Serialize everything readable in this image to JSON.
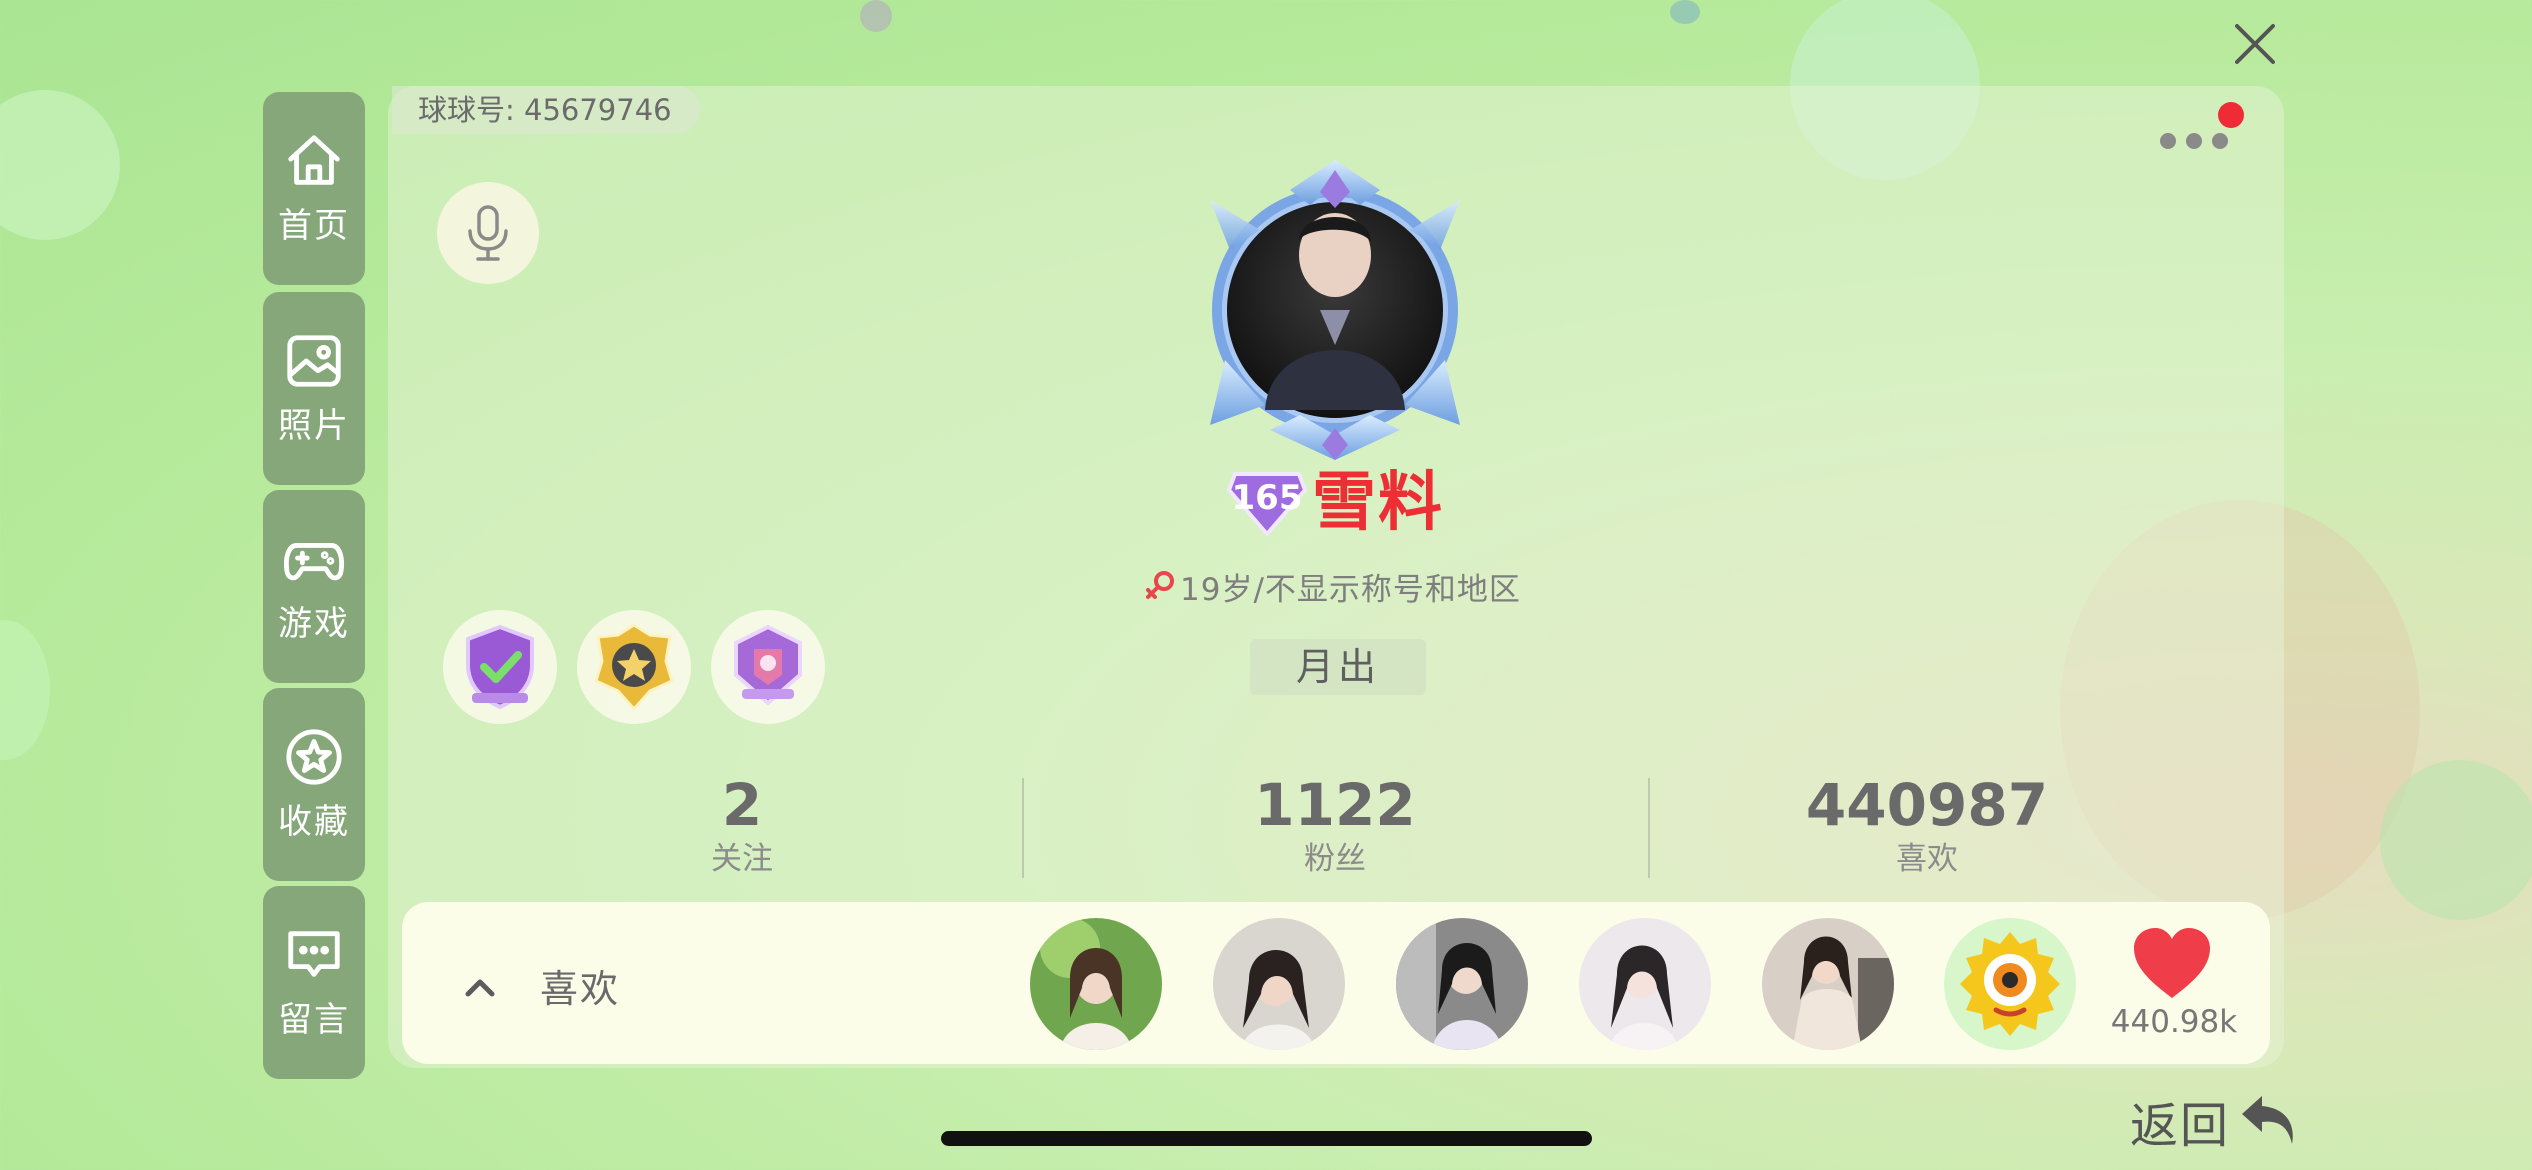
{
  "header": {
    "uid_label": "球球号: 45679746"
  },
  "sidebar": {
    "items": [
      {
        "label": "首页",
        "icon": "home-icon"
      },
      {
        "label": "照片",
        "icon": "photo-icon"
      },
      {
        "label": "游戏",
        "icon": "gamepad-icon"
      },
      {
        "label": "收藏",
        "icon": "star-icon"
      },
      {
        "label": "留言",
        "icon": "message-icon"
      }
    ]
  },
  "profile": {
    "level": "165",
    "nickname": "雪料",
    "info": "19岁/不显示称号和地区",
    "sign": "月出",
    "medals": [
      "verified-shield-medal",
      "gold-star-medal",
      "purple-badge-medal"
    ]
  },
  "stats": [
    {
      "value": "2",
      "label": "关注"
    },
    {
      "value": "1122",
      "label": "粉丝"
    },
    {
      "value": "440987",
      "label": "喜欢"
    }
  ],
  "likes": {
    "label": "喜欢",
    "count": "440.98k",
    "avatars": [
      "liker-avatar-1",
      "liker-avatar-2",
      "liker-avatar-3",
      "liker-avatar-4",
      "liker-avatar-5"
    ]
  },
  "footer": {
    "back_label": "返回"
  },
  "colors": {
    "accent_red": "#ec2f34",
    "sidebar_bg": "#85a77a",
    "bg_green": "#b7ea9c",
    "notification_dot": "#ef2b36"
  }
}
